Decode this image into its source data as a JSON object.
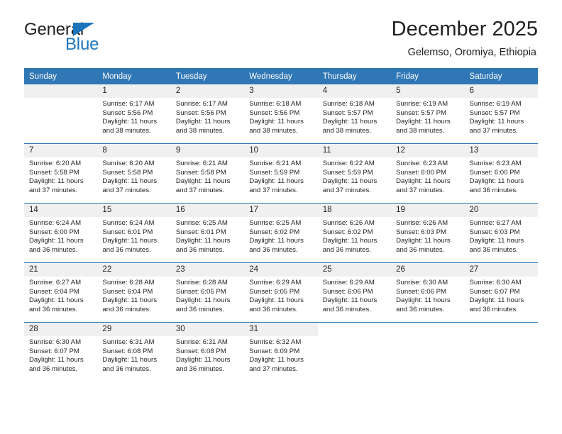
{
  "brand": {
    "name_top": "General",
    "name_bottom": "Blue",
    "triangle_icon": "triangle-icon",
    "accent_color": "#1b75bb"
  },
  "header": {
    "title": "December 2025",
    "subtitle": "Gelemso, Oromiya, Ethiopia",
    "header_bg_color": "#3077b5",
    "daynum_bg_color": "#f0f0f0"
  },
  "weekday_headers": [
    "Sunday",
    "Monday",
    "Tuesday",
    "Wednesday",
    "Thursday",
    "Friday",
    "Saturday"
  ],
  "labels": {
    "sunrise": "Sunrise:",
    "sunset": "Sunset:",
    "daylight": "Daylight:"
  },
  "weeks": [
    [
      {
        "day": "",
        "sunrise": "",
        "sunset": "",
        "daylight": "",
        "empty": true
      },
      {
        "day": "1",
        "sunrise": "Sunrise: 6:17 AM",
        "sunset": "Sunset: 5:56 PM",
        "daylight": "Daylight: 11 hours and 38 minutes."
      },
      {
        "day": "2",
        "sunrise": "Sunrise: 6:17 AM",
        "sunset": "Sunset: 5:56 PM",
        "daylight": "Daylight: 11 hours and 38 minutes."
      },
      {
        "day": "3",
        "sunrise": "Sunrise: 6:18 AM",
        "sunset": "Sunset: 5:56 PM",
        "daylight": "Daylight: 11 hours and 38 minutes."
      },
      {
        "day": "4",
        "sunrise": "Sunrise: 6:18 AM",
        "sunset": "Sunset: 5:57 PM",
        "daylight": "Daylight: 11 hours and 38 minutes."
      },
      {
        "day": "5",
        "sunrise": "Sunrise: 6:19 AM",
        "sunset": "Sunset: 5:57 PM",
        "daylight": "Daylight: 11 hours and 38 minutes."
      },
      {
        "day": "6",
        "sunrise": "Sunrise: 6:19 AM",
        "sunset": "Sunset: 5:57 PM",
        "daylight": "Daylight: 11 hours and 37 minutes."
      }
    ],
    [
      {
        "day": "7",
        "sunrise": "Sunrise: 6:20 AM",
        "sunset": "Sunset: 5:58 PM",
        "daylight": "Daylight: 11 hours and 37 minutes."
      },
      {
        "day": "8",
        "sunrise": "Sunrise: 6:20 AM",
        "sunset": "Sunset: 5:58 PM",
        "daylight": "Daylight: 11 hours and 37 minutes."
      },
      {
        "day": "9",
        "sunrise": "Sunrise: 6:21 AM",
        "sunset": "Sunset: 5:58 PM",
        "daylight": "Daylight: 11 hours and 37 minutes."
      },
      {
        "day": "10",
        "sunrise": "Sunrise: 6:21 AM",
        "sunset": "Sunset: 5:59 PM",
        "daylight": "Daylight: 11 hours and 37 minutes."
      },
      {
        "day": "11",
        "sunrise": "Sunrise: 6:22 AM",
        "sunset": "Sunset: 5:59 PM",
        "daylight": "Daylight: 11 hours and 37 minutes."
      },
      {
        "day": "12",
        "sunrise": "Sunrise: 6:23 AM",
        "sunset": "Sunset: 6:00 PM",
        "daylight": "Daylight: 11 hours and 37 minutes."
      },
      {
        "day": "13",
        "sunrise": "Sunrise: 6:23 AM",
        "sunset": "Sunset: 6:00 PM",
        "daylight": "Daylight: 11 hours and 36 minutes."
      }
    ],
    [
      {
        "day": "14",
        "sunrise": "Sunrise: 6:24 AM",
        "sunset": "Sunset: 6:00 PM",
        "daylight": "Daylight: 11 hours and 36 minutes."
      },
      {
        "day": "15",
        "sunrise": "Sunrise: 6:24 AM",
        "sunset": "Sunset: 6:01 PM",
        "daylight": "Daylight: 11 hours and 36 minutes."
      },
      {
        "day": "16",
        "sunrise": "Sunrise: 6:25 AM",
        "sunset": "Sunset: 6:01 PM",
        "daylight": "Daylight: 11 hours and 36 minutes."
      },
      {
        "day": "17",
        "sunrise": "Sunrise: 6:25 AM",
        "sunset": "Sunset: 6:02 PM",
        "daylight": "Daylight: 11 hours and 36 minutes."
      },
      {
        "day": "18",
        "sunrise": "Sunrise: 6:26 AM",
        "sunset": "Sunset: 6:02 PM",
        "daylight": "Daylight: 11 hours and 36 minutes."
      },
      {
        "day": "19",
        "sunrise": "Sunrise: 6:26 AM",
        "sunset": "Sunset: 6:03 PM",
        "daylight": "Daylight: 11 hours and 36 minutes."
      },
      {
        "day": "20",
        "sunrise": "Sunrise: 6:27 AM",
        "sunset": "Sunset: 6:03 PM",
        "daylight": "Daylight: 11 hours and 36 minutes."
      }
    ],
    [
      {
        "day": "21",
        "sunrise": "Sunrise: 6:27 AM",
        "sunset": "Sunset: 6:04 PM",
        "daylight": "Daylight: 11 hours and 36 minutes."
      },
      {
        "day": "22",
        "sunrise": "Sunrise: 6:28 AM",
        "sunset": "Sunset: 6:04 PM",
        "daylight": "Daylight: 11 hours and 36 minutes."
      },
      {
        "day": "23",
        "sunrise": "Sunrise: 6:28 AM",
        "sunset": "Sunset: 6:05 PM",
        "daylight": "Daylight: 11 hours and 36 minutes."
      },
      {
        "day": "24",
        "sunrise": "Sunrise: 6:29 AM",
        "sunset": "Sunset: 6:05 PM",
        "daylight": "Daylight: 11 hours and 36 minutes."
      },
      {
        "day": "25",
        "sunrise": "Sunrise: 6:29 AM",
        "sunset": "Sunset: 6:06 PM",
        "daylight": "Daylight: 11 hours and 36 minutes."
      },
      {
        "day": "26",
        "sunrise": "Sunrise: 6:30 AM",
        "sunset": "Sunset: 6:06 PM",
        "daylight": "Daylight: 11 hours and 36 minutes."
      },
      {
        "day": "27",
        "sunrise": "Sunrise: 6:30 AM",
        "sunset": "Sunset: 6:07 PM",
        "daylight": "Daylight: 11 hours and 36 minutes."
      }
    ],
    [
      {
        "day": "28",
        "sunrise": "Sunrise: 6:30 AM",
        "sunset": "Sunset: 6:07 PM",
        "daylight": "Daylight: 11 hours and 36 minutes."
      },
      {
        "day": "29",
        "sunrise": "Sunrise: 6:31 AM",
        "sunset": "Sunset: 6:08 PM",
        "daylight": "Daylight: 11 hours and 36 minutes."
      },
      {
        "day": "30",
        "sunrise": "Sunrise: 6:31 AM",
        "sunset": "Sunset: 6:08 PM",
        "daylight": "Daylight: 11 hours and 36 minutes."
      },
      {
        "day": "31",
        "sunrise": "Sunrise: 6:32 AM",
        "sunset": "Sunset: 6:09 PM",
        "daylight": "Daylight: 11 hours and 37 minutes."
      },
      {
        "day": "",
        "sunrise": "",
        "sunset": "",
        "daylight": "",
        "void": true
      },
      {
        "day": "",
        "sunrise": "",
        "sunset": "",
        "daylight": "",
        "void": true
      },
      {
        "day": "",
        "sunrise": "",
        "sunset": "",
        "daylight": "",
        "void": true
      }
    ]
  ]
}
